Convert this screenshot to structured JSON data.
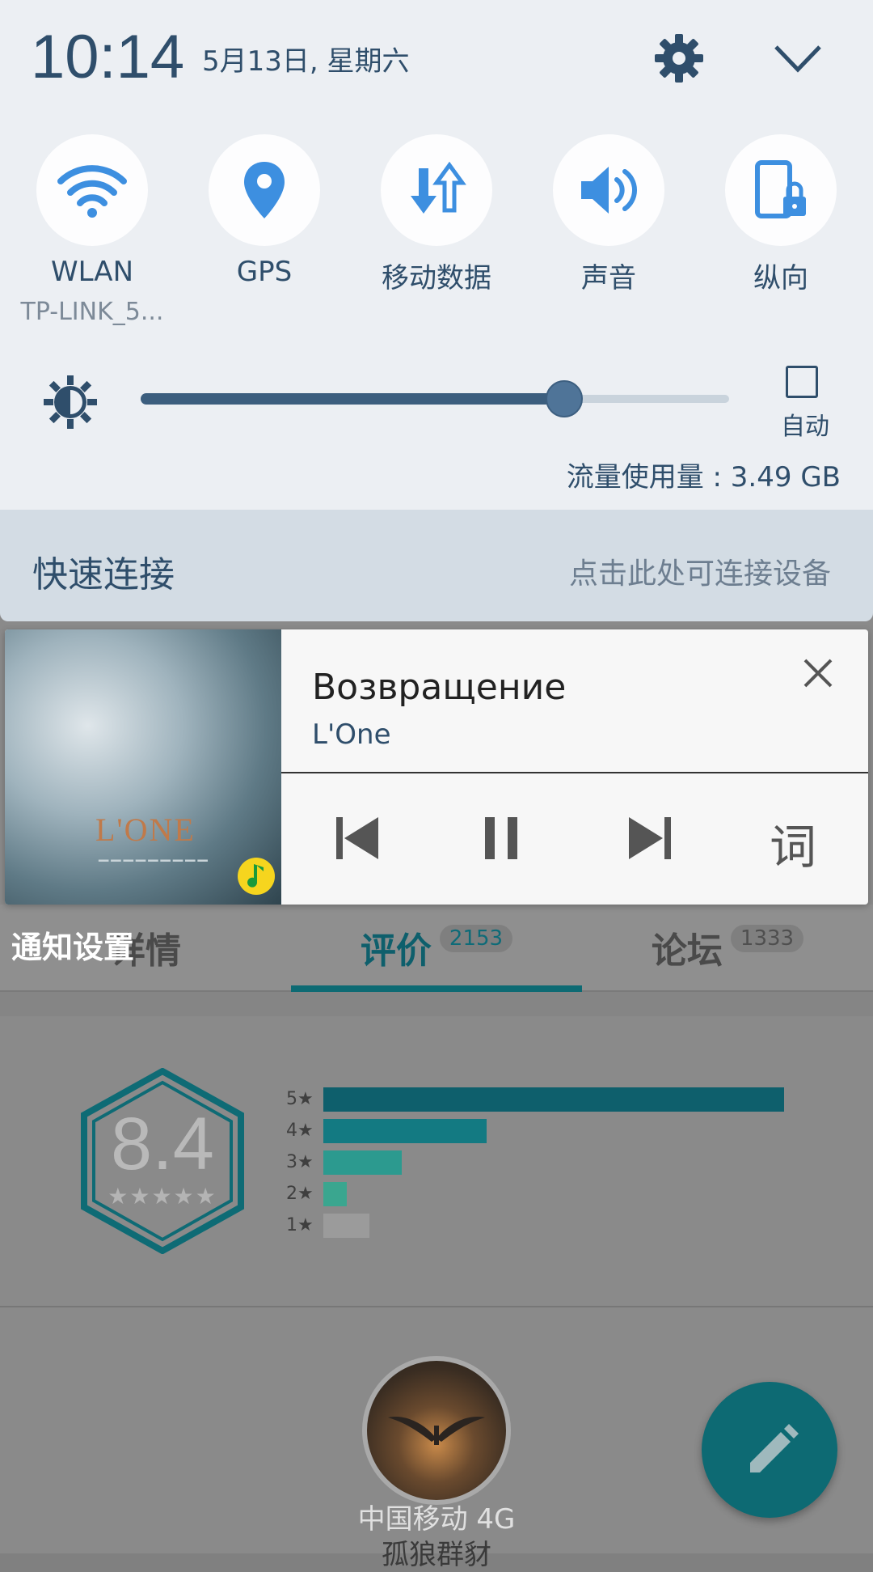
{
  "status": {
    "time": "10:14",
    "date": "5月13日, 星期六"
  },
  "tiles": [
    {
      "label": "WLAN",
      "sub": "TP-LINK_5..."
    },
    {
      "label": "GPS"
    },
    {
      "label": "移动数据"
    },
    {
      "label": "声音"
    },
    {
      "label": "纵向"
    }
  ],
  "brightness": {
    "level": 0.72,
    "auto_label": "自动"
  },
  "data_usage": "流量使用量 : 3.49 GB",
  "quick_connect": {
    "title": "快速连接",
    "hint": "点击此处可连接设备"
  },
  "music": {
    "title": "Возвращение",
    "artist": "L'One",
    "album_text": "L'ONE",
    "lyric_label": "词"
  },
  "background_app": {
    "notif_settings": "通知设置",
    "tabs": [
      {
        "label": "详情"
      },
      {
        "label": "评价",
        "count": "2153"
      },
      {
        "label": "论坛",
        "count": "1333"
      }
    ],
    "score": "8.4",
    "score_stars": "★★★★★",
    "rating_bars": [
      {
        "label": "5★",
        "fraction": 1.0,
        "color": "#0e5f6c"
      },
      {
        "label": "4★",
        "fraction": 0.355,
        "color": "#137a82"
      },
      {
        "label": "3★",
        "fraction": 0.17,
        "color": "#2c9a8f"
      },
      {
        "label": "2★",
        "fraction": 0.05,
        "color": "#3aa68f"
      },
      {
        "label": "1★",
        "fraction": 0.1,
        "color": "#9b9b9b"
      }
    ],
    "carrier": "中国移动 4G",
    "carrier_sub": "孤狼群豺"
  },
  "colors": {
    "accent": "#2f4e6b",
    "icon_blue": "#3d8fe0",
    "teal": "#0d6a73"
  }
}
